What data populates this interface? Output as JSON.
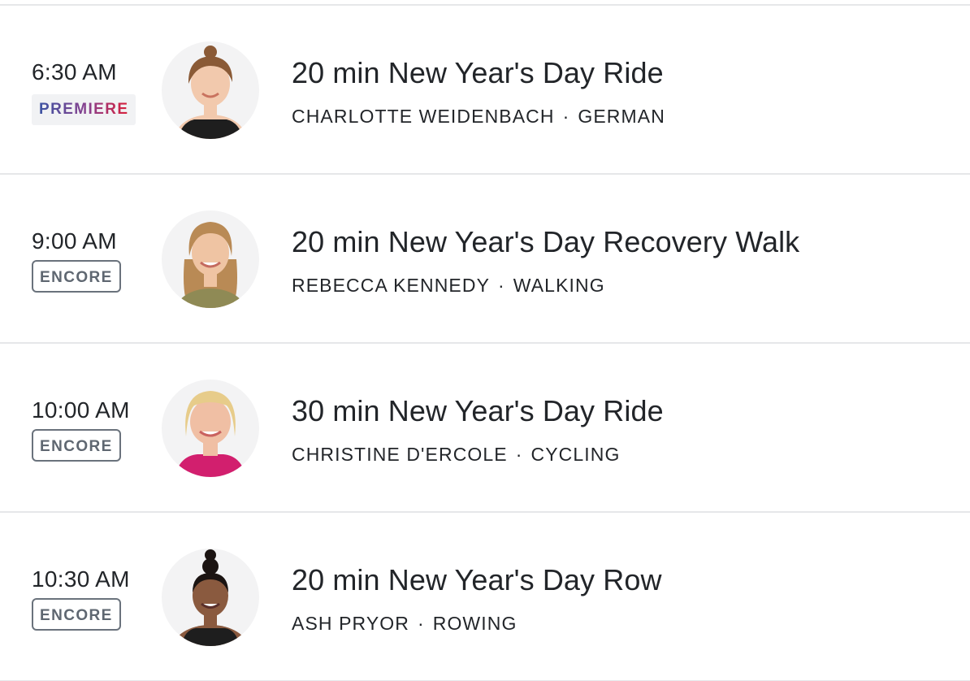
{
  "classes": [
    {
      "time": "6:30 AM",
      "badge": "PREMIERE",
      "title": "20 min New Year's Day Ride",
      "instructor": "CHARLOTTE WEIDENBACH",
      "separator": "·",
      "category": "GERMAN",
      "avatar": {
        "hair": "#8a5a36",
        "skin": "#f2c9ad",
        "top": "#1e1e1e"
      }
    },
    {
      "time": "9:00 AM",
      "badge": "ENCORE",
      "title": "20 min New Year's Day Recovery Walk",
      "instructor": "REBECCA KENNEDY",
      "separator": "·",
      "category": "WALKING",
      "avatar": {
        "hair": "#b98a55",
        "skin": "#efc4a3",
        "top": "#8f8a55"
      }
    },
    {
      "time": "10:00 AM",
      "badge": "ENCORE",
      "title": "30 min New Year's Day Ride",
      "instructor": "CHRISTINE D'ERCOLE",
      "separator": "·",
      "category": "CYCLING",
      "avatar": {
        "hair": "#e7cc8a",
        "skin": "#f0bfa4",
        "top": "#d21f6e"
      }
    },
    {
      "time": "10:30 AM",
      "badge": "ENCORE",
      "title": "20 min New Year's Day Row",
      "instructor": "ASH PRYOR",
      "separator": "·",
      "category": "ROWING",
      "avatar": {
        "hair": "#1b1412",
        "skin": "#8a5a3f",
        "top": "#1e1e1e"
      }
    }
  ]
}
